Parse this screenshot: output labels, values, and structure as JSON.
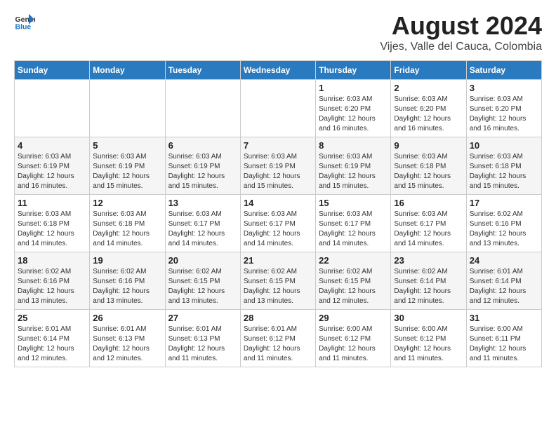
{
  "header": {
    "logo_general": "General",
    "logo_blue": "Blue",
    "title": "August 2024",
    "subtitle": "Vijes, Valle del Cauca, Colombia"
  },
  "days_of_week": [
    "Sunday",
    "Monday",
    "Tuesday",
    "Wednesday",
    "Thursday",
    "Friday",
    "Saturday"
  ],
  "weeks": [
    [
      {
        "day": "",
        "info": ""
      },
      {
        "day": "",
        "info": ""
      },
      {
        "day": "",
        "info": ""
      },
      {
        "day": "",
        "info": ""
      },
      {
        "day": "1",
        "info": "Sunrise: 6:03 AM\nSunset: 6:20 PM\nDaylight: 12 hours and 16 minutes."
      },
      {
        "day": "2",
        "info": "Sunrise: 6:03 AM\nSunset: 6:20 PM\nDaylight: 12 hours and 16 minutes."
      },
      {
        "day": "3",
        "info": "Sunrise: 6:03 AM\nSunset: 6:20 PM\nDaylight: 12 hours and 16 minutes."
      }
    ],
    [
      {
        "day": "4",
        "info": "Sunrise: 6:03 AM\nSunset: 6:19 PM\nDaylight: 12 hours and 16 minutes."
      },
      {
        "day": "5",
        "info": "Sunrise: 6:03 AM\nSunset: 6:19 PM\nDaylight: 12 hours and 15 minutes."
      },
      {
        "day": "6",
        "info": "Sunrise: 6:03 AM\nSunset: 6:19 PM\nDaylight: 12 hours and 15 minutes."
      },
      {
        "day": "7",
        "info": "Sunrise: 6:03 AM\nSunset: 6:19 PM\nDaylight: 12 hours and 15 minutes."
      },
      {
        "day": "8",
        "info": "Sunrise: 6:03 AM\nSunset: 6:19 PM\nDaylight: 12 hours and 15 minutes."
      },
      {
        "day": "9",
        "info": "Sunrise: 6:03 AM\nSunset: 6:18 PM\nDaylight: 12 hours and 15 minutes."
      },
      {
        "day": "10",
        "info": "Sunrise: 6:03 AM\nSunset: 6:18 PM\nDaylight: 12 hours and 15 minutes."
      }
    ],
    [
      {
        "day": "11",
        "info": "Sunrise: 6:03 AM\nSunset: 6:18 PM\nDaylight: 12 hours and 14 minutes."
      },
      {
        "day": "12",
        "info": "Sunrise: 6:03 AM\nSunset: 6:18 PM\nDaylight: 12 hours and 14 minutes."
      },
      {
        "day": "13",
        "info": "Sunrise: 6:03 AM\nSunset: 6:17 PM\nDaylight: 12 hours and 14 minutes."
      },
      {
        "day": "14",
        "info": "Sunrise: 6:03 AM\nSunset: 6:17 PM\nDaylight: 12 hours and 14 minutes."
      },
      {
        "day": "15",
        "info": "Sunrise: 6:03 AM\nSunset: 6:17 PM\nDaylight: 12 hours and 14 minutes."
      },
      {
        "day": "16",
        "info": "Sunrise: 6:03 AM\nSunset: 6:17 PM\nDaylight: 12 hours and 14 minutes."
      },
      {
        "day": "17",
        "info": "Sunrise: 6:02 AM\nSunset: 6:16 PM\nDaylight: 12 hours and 13 minutes."
      }
    ],
    [
      {
        "day": "18",
        "info": "Sunrise: 6:02 AM\nSunset: 6:16 PM\nDaylight: 12 hours and 13 minutes."
      },
      {
        "day": "19",
        "info": "Sunrise: 6:02 AM\nSunset: 6:16 PM\nDaylight: 12 hours and 13 minutes."
      },
      {
        "day": "20",
        "info": "Sunrise: 6:02 AM\nSunset: 6:15 PM\nDaylight: 12 hours and 13 minutes."
      },
      {
        "day": "21",
        "info": "Sunrise: 6:02 AM\nSunset: 6:15 PM\nDaylight: 12 hours and 13 minutes."
      },
      {
        "day": "22",
        "info": "Sunrise: 6:02 AM\nSunset: 6:15 PM\nDaylight: 12 hours and 12 minutes."
      },
      {
        "day": "23",
        "info": "Sunrise: 6:02 AM\nSunset: 6:14 PM\nDaylight: 12 hours and 12 minutes."
      },
      {
        "day": "24",
        "info": "Sunrise: 6:01 AM\nSunset: 6:14 PM\nDaylight: 12 hours and 12 minutes."
      }
    ],
    [
      {
        "day": "25",
        "info": "Sunrise: 6:01 AM\nSunset: 6:14 PM\nDaylight: 12 hours and 12 minutes."
      },
      {
        "day": "26",
        "info": "Sunrise: 6:01 AM\nSunset: 6:13 PM\nDaylight: 12 hours and 12 minutes."
      },
      {
        "day": "27",
        "info": "Sunrise: 6:01 AM\nSunset: 6:13 PM\nDaylight: 12 hours and 11 minutes."
      },
      {
        "day": "28",
        "info": "Sunrise: 6:01 AM\nSunset: 6:12 PM\nDaylight: 12 hours and 11 minutes."
      },
      {
        "day": "29",
        "info": "Sunrise: 6:00 AM\nSunset: 6:12 PM\nDaylight: 12 hours and 11 minutes."
      },
      {
        "day": "30",
        "info": "Sunrise: 6:00 AM\nSunset: 6:12 PM\nDaylight: 12 hours and 11 minutes."
      },
      {
        "day": "31",
        "info": "Sunrise: 6:00 AM\nSunset: 6:11 PM\nDaylight: 12 hours and 11 minutes."
      }
    ]
  ]
}
